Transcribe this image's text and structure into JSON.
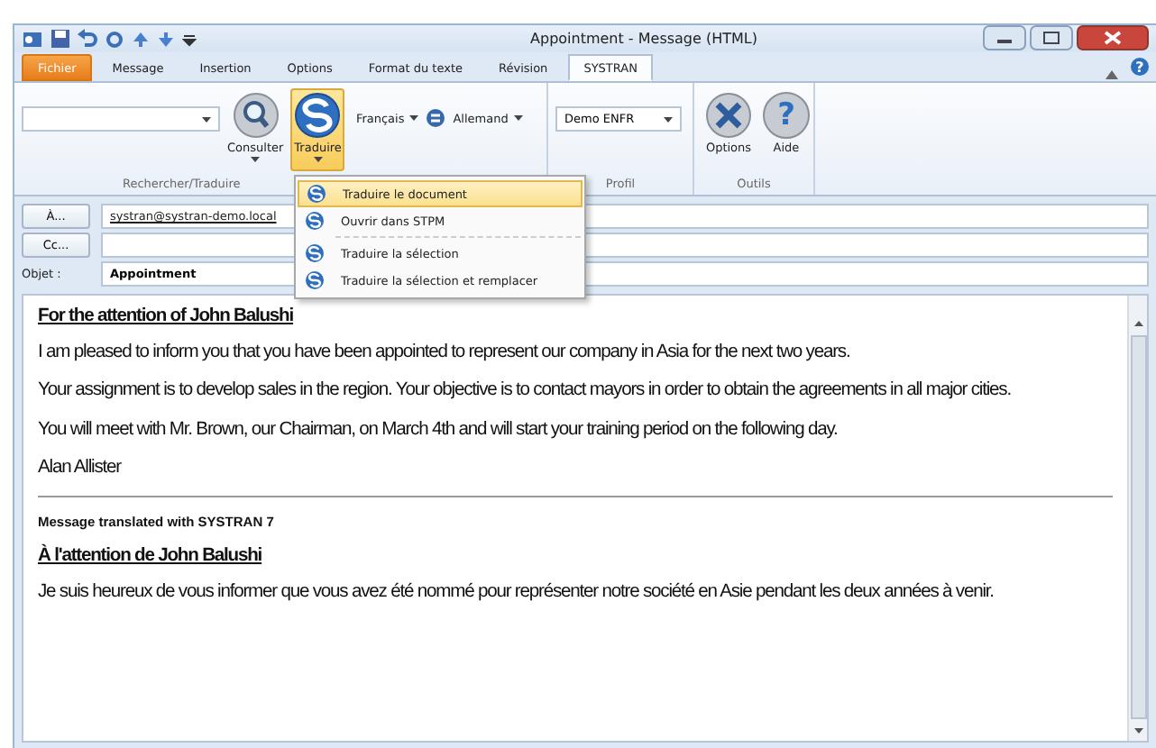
{
  "window": {
    "title": "Appointment - Message (HTML)",
    "help_glyph": "?"
  },
  "tabs": [
    {
      "label": "Fichier",
      "selected": false,
      "kind": "file"
    },
    {
      "label": "Message",
      "selected": false,
      "kind": "tab"
    },
    {
      "label": "Insertion",
      "selected": false,
      "kind": "tab"
    },
    {
      "label": "Options",
      "selected": false,
      "kind": "tab"
    },
    {
      "label": "Format du texte",
      "selected": false,
      "kind": "tab"
    },
    {
      "label": "Révision",
      "selected": false,
      "kind": "tab"
    },
    {
      "label": "SYSTRAN",
      "selected": true,
      "kind": "tab"
    }
  ],
  "ribbon": {
    "consult": {
      "label": "Consulter"
    },
    "translate": {
      "label": "Traduire",
      "pressed": true
    },
    "source_language": "Français",
    "target_language": "Allemand",
    "profile": "Demo ENFR",
    "options": {
      "label": "Options"
    },
    "help": {
      "label": "Aide",
      "glyph": "?"
    },
    "group_labels": [
      "Rechercher/Traduire",
      "Profil",
      "Outils"
    ]
  },
  "menu": [
    {
      "label": "Traduire le document",
      "highlighted": true,
      "separator_after": false
    },
    {
      "label": "Ouvrir dans STPM",
      "highlighted": false,
      "separator_after": true
    },
    {
      "label": "Traduire la sélection",
      "highlighted": false,
      "separator_after": false
    },
    {
      "label": "Traduire la sélection et remplacer",
      "highlighted": false,
      "separator_after": false
    }
  ],
  "header": {
    "to_button": "À...",
    "to_value": "systran@systran-demo.local",
    "cc_button": "Cc...",
    "subject_label": "Objet :",
    "subject_value": "Appointment"
  },
  "body": [
    {
      "kind": "heading",
      "text": "For the attention of John Balushi"
    },
    {
      "kind": "para",
      "text": "I am pleased to inform you that you have been appointed to represent our company in Asia for the next two years."
    },
    {
      "kind": "para",
      "text": "Your assignment is to develop sales in the region. Your objective is to contact  mayors  in order to obtain the agreements in all major cities."
    },
    {
      "kind": "para",
      "text": "You will meet with Mr. Brown, our Chairman, on March 4th and will start your training period on the following day."
    },
    {
      "kind": "para",
      "text": "Alan Allister"
    },
    {
      "kind": "rule"
    },
    {
      "kind": "note",
      "text": "Message translated with SYSTRAN 7"
    },
    {
      "kind": "heading",
      "text": "À l'attention de John Balushi"
    },
    {
      "kind": "para",
      "text": "Je suis heureux de vous informer que vous avez été nommé pour représenter notre société en Asie pendant les deux années à venir."
    }
  ]
}
